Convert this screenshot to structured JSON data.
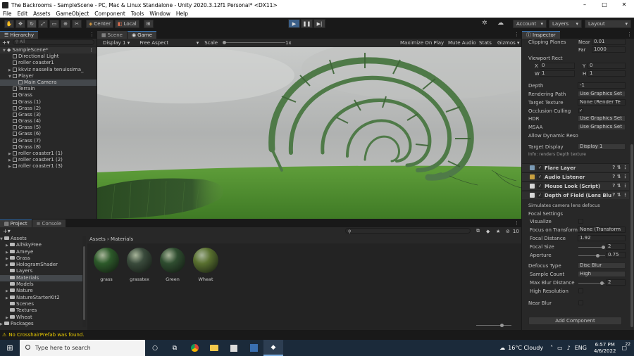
{
  "window": {
    "title": "The Backrooms - SampleScene - PC, Mac & Linux Standalone - Unity 2020.3.12f1 Personal* <DX11>",
    "controls": [
      "–",
      "□",
      "✕"
    ]
  },
  "menu": [
    "File",
    "Edit",
    "Assets",
    "GameObject",
    "Component",
    "Tools",
    "Window",
    "Help"
  ],
  "toolbar": {
    "pivot": "Center",
    "space": "Local",
    "account": "Account",
    "layers": "Layers",
    "layout": "Layout"
  },
  "hierarchy": {
    "tab": "Hierarchy",
    "search_placeholder": "All",
    "scene": "SampleScene*",
    "items": [
      {
        "label": "Directional Light",
        "indent": 1
      },
      {
        "label": "roller coaster1",
        "indent": 1
      },
      {
        "label": "kkviz nassella tenuissima_",
        "indent": 1
      },
      {
        "label": "Player",
        "indent": 1
      },
      {
        "label": "Main Camera",
        "indent": 2
      },
      {
        "label": "Terrain",
        "indent": 1
      },
      {
        "label": "Grass",
        "indent": 1
      },
      {
        "label": "Grass (1)",
        "indent": 1
      },
      {
        "label": "Grass (2)",
        "indent": 1
      },
      {
        "label": "Grass (3)",
        "indent": 1
      },
      {
        "label": "Grass (4)",
        "indent": 1
      },
      {
        "label": "Grass (5)",
        "indent": 1
      },
      {
        "label": "Grass (6)",
        "indent": 1
      },
      {
        "label": "Grass (7)",
        "indent": 1
      },
      {
        "label": "Grass (8)",
        "indent": 1
      },
      {
        "label": "roller coaster1 (1)",
        "indent": 1
      },
      {
        "label": "roller coaster1 (2)",
        "indent": 1
      },
      {
        "label": "roller coaster1 (3)",
        "indent": 1
      }
    ]
  },
  "game": {
    "tabs": [
      "Scene",
      "Game"
    ],
    "display": "Display 1",
    "aspect": "Free Aspect",
    "scale_label": "Scale",
    "scale_value": "1x",
    "maximize": "Maximize On Play",
    "mute": "Mute Audio",
    "stats": "Stats",
    "gizmos": "Gizmos"
  },
  "inspector": {
    "tab": "Inspector",
    "clipping_planes": "Clipping Planes",
    "near_label": "Near",
    "near": "0.01",
    "far_label": "Far",
    "far": "1000",
    "viewport_rect": "Viewport Rect",
    "x_label": "X",
    "x": "0",
    "y_label": "Y",
    "y": "0",
    "w_label": "W",
    "w": "1",
    "h_label": "H",
    "h": "1",
    "depth_label": "Depth",
    "depth": "-1",
    "rendering_path_label": "Rendering Path",
    "rendering_path": "Use Graphics Set",
    "target_texture_label": "Target Texture",
    "target_texture": "None (Render Te",
    "occlusion_label": "Occlusion Culling",
    "occlusion": "✓",
    "hdr_label": "HDR",
    "hdr": "Use Graphics Set",
    "msaa_label": "MSAA",
    "msaa": "Use Graphics Set",
    "dynres_label": "Allow Dynamic Reso",
    "target_display_label": "Target Display",
    "target_display": "Display 1",
    "info": "Info: renders Depth texture",
    "components": [
      "Flare Layer",
      "Audio Listener",
      "Mouse Look (Script)",
      "Depth of Field (Lens Blu"
    ],
    "dof_desc": "Simulates camera lens defocus",
    "focal_settings": "Focal Settings",
    "visualize_label": "Visualize",
    "focus_transform_label": "Focus on Transform",
    "focus_transform": "None (Transform",
    "focal_distance_label": "Focal Distance",
    "focal_distance": "1.92",
    "focal_size_label": "Focal Size",
    "focal_size": "2",
    "aperture_label": "Aperture",
    "aperture": "0.75",
    "defocus_type_label": "Defocus Type",
    "defocus_type": "Disc Blur",
    "sample_count_label": "Sample Count",
    "sample_count": "High",
    "max_blur_label": "Max Blur Distance",
    "max_blur": "2",
    "high_res_label": "High Resolution",
    "near_blur_label": "Near Blur",
    "add_component": "Add Component"
  },
  "project": {
    "tabs": [
      "Project",
      "Console"
    ],
    "folders_root": "Assets",
    "folders": [
      "AllSkyFree",
      "Ameye",
      "Grass",
      "HologramShader",
      "Layers",
      "Materials",
      "Models",
      "Nature",
      "NatureStarterKit2",
      "Scenes",
      "Textures",
      "Wheat"
    ],
    "packages": "Packages",
    "breadcrumb": "Assets › Materials",
    "count": "10",
    "assets": [
      {
        "name": "grass",
        "color": "#2d5a2a"
      },
      {
        "name": "grasstex",
        "color": "#3a4b3c"
      },
      {
        "name": "Green",
        "color": "#2f4d30"
      },
      {
        "name": "Wheat",
        "color": "#59702f"
      }
    ]
  },
  "status": "No CrosshairPrefab was found.",
  "taskbar": {
    "search_placeholder": "Type here to search",
    "weather": "16°C  Cloudy",
    "lang": "ENG",
    "time": "6:57 PM",
    "date": "4/6/2022",
    "notifications": "22"
  }
}
